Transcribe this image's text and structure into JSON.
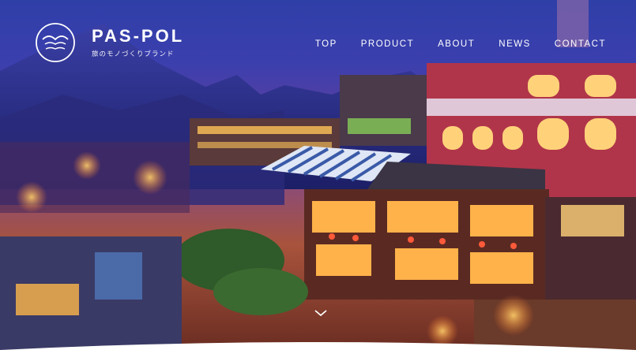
{
  "header": {
    "brand_name": "PAS-POL",
    "brand_tagline": "旅のモノづくりブランド"
  },
  "nav": {
    "items": [
      {
        "label": "TOP"
      },
      {
        "label": "PRODUCT"
      },
      {
        "label": "ABOUT"
      },
      {
        "label": "NEWS"
      },
      {
        "label": "CONTACT"
      }
    ]
  },
  "hero": {
    "scroll_icon": "chevron-down-icon"
  },
  "colors": {
    "sky_top": "#2f3fa8",
    "mountain": "#2a2f8c",
    "lantern": "#ff6a3a",
    "text": "#ffffff"
  }
}
